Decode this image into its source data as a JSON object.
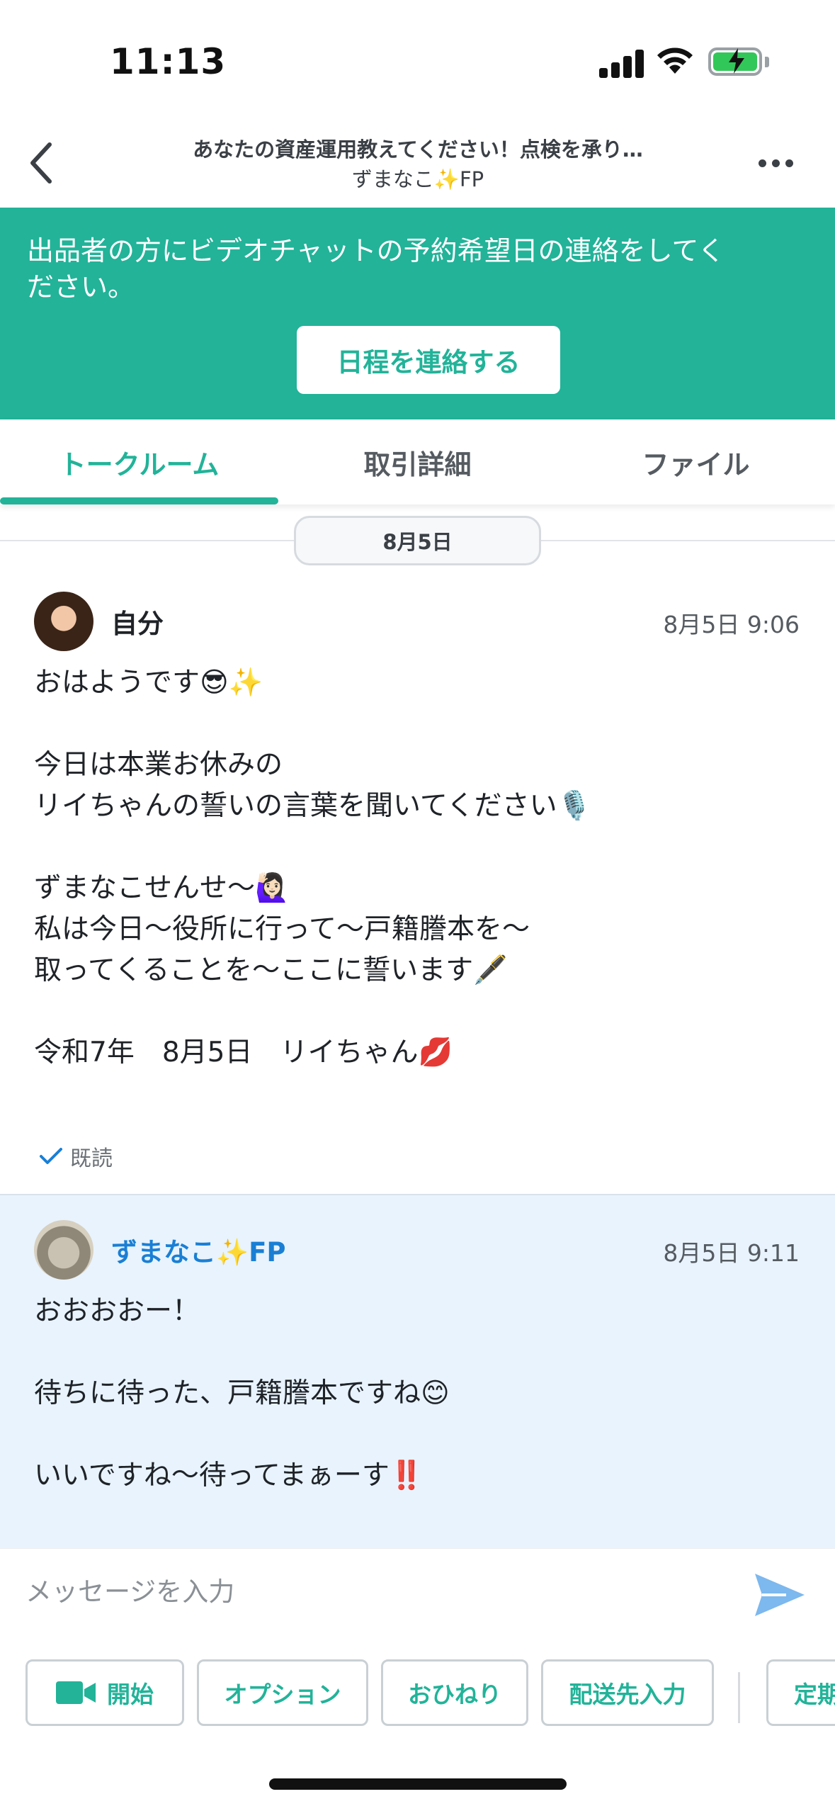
{
  "status_bar": {
    "time": "11:13"
  },
  "header": {
    "title": "あなたの資産運用教えてください！点検を承り…",
    "subtitle": "ずまなこ✨FP"
  },
  "banner": {
    "text": "出品者の方にビデオチャットの予約希望日の連絡をしてください。",
    "button_label": "日程を連絡する"
  },
  "tabs": [
    {
      "label": "トークルーム",
      "active": true
    },
    {
      "label": "取引詳細",
      "active": false
    },
    {
      "label": "ファイル",
      "active": false
    }
  ],
  "date_separator": "8月5日",
  "messages": [
    {
      "sender": "自分",
      "time": "8月5日 9:06",
      "lines": [
        "おはようです😎✨",
        "",
        "今日は本業お休みの",
        "リイちゃんの誓いの言葉を聞いてください🎙️",
        "",
        "ずまなこせんせ〜🙋🏻‍♀️",
        "私は今日〜役所に行って〜戸籍謄本を〜",
        "取ってくることを〜ここに誓います🖋️",
        "",
        "令和7年　8月5日　リイちゃん💋"
      ],
      "read_label": "既読"
    },
    {
      "sender": "ずまなこ✨FP",
      "time": "8月5日 9:11",
      "lines": [
        "おおおおー！",
        "",
        "待ちに待った、戸籍謄本ですね😊",
        "",
        "いいですね〜待ってまぁーす‼️"
      ]
    }
  ],
  "input": {
    "placeholder": "メッセージを入力"
  },
  "actions": [
    {
      "label": "開始",
      "icon": "video-camera-icon"
    },
    {
      "label": "オプション"
    },
    {
      "label": "おひねり"
    },
    {
      "label": "配送先入力"
    },
    {
      "label": "定期"
    }
  ],
  "colors": {
    "accent": "#22b399",
    "sender_blue": "#1a7fd4",
    "partner_bg": "#e8f3fd",
    "send_icon": "#7db8ee"
  }
}
